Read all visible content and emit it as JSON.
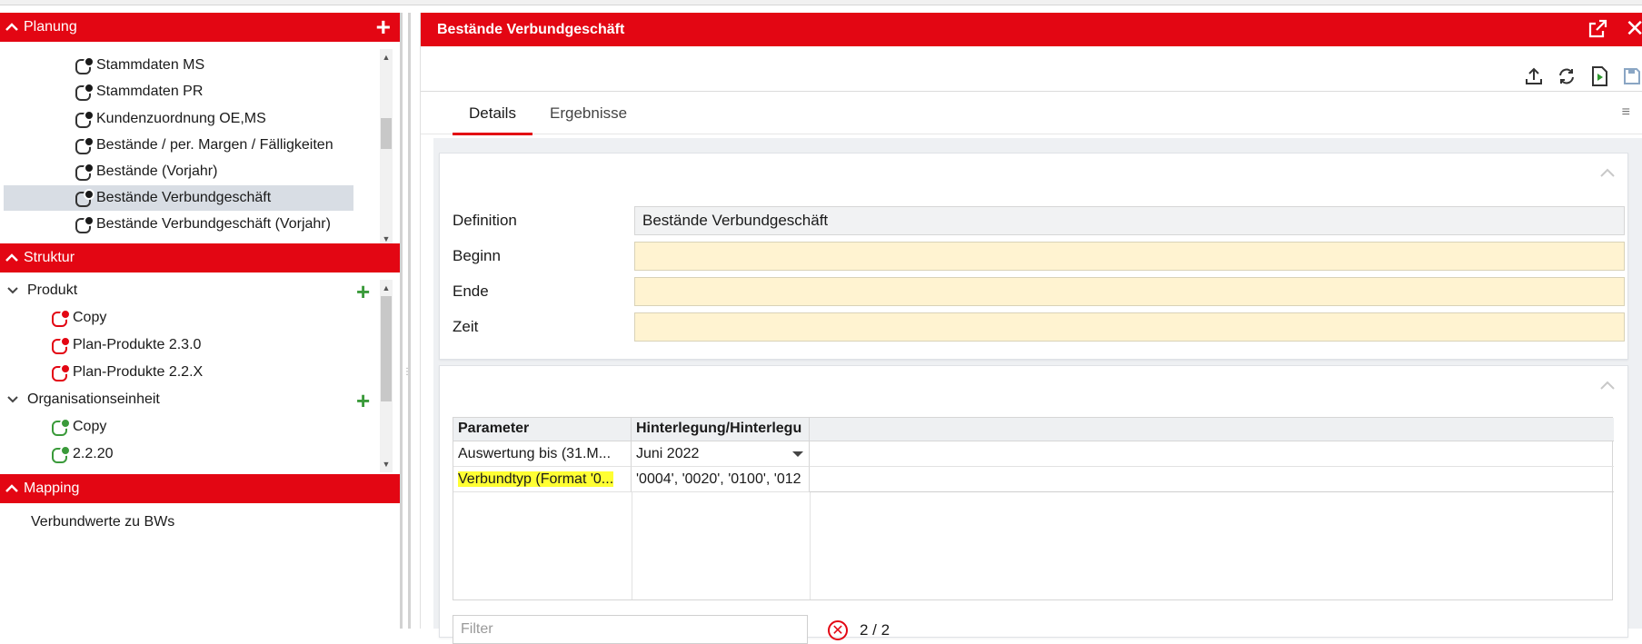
{
  "colors": {
    "accent": "#e30613",
    "selected_row": "#d8dde4",
    "input_required": "#fff3d1",
    "highlight": "#ffff33",
    "green": "#3a9a3a"
  },
  "left": {
    "planung": {
      "title": "Planung",
      "items": [
        {
          "label": "Stammdaten MS"
        },
        {
          "label": "Stammdaten PR"
        },
        {
          "label": "Kundenzuordnung OE,MS"
        },
        {
          "label": "Bestände / per. Margen / Fälligkeiten"
        },
        {
          "label": "Bestände (Vorjahr)"
        },
        {
          "label": "Bestände Verbundgeschäft"
        },
        {
          "label": "Bestände Verbundgeschäft (Vorjahr)"
        }
      ]
    },
    "struktur": {
      "title": "Struktur",
      "groups": [
        {
          "label": "Produkt",
          "children": [
            {
              "label": "Copy"
            },
            {
              "label": "Plan-Produkte 2.3.0"
            },
            {
              "label": "Plan-Produkte 2.2.X"
            }
          ]
        },
        {
          "label": "Organisationseinheit",
          "children": [
            {
              "label": "Copy"
            },
            {
              "label": "2.2.20"
            }
          ]
        }
      ]
    },
    "mapping": {
      "title": "Mapping",
      "items": [
        {
          "label": "Verbundwerte zu BWs"
        }
      ]
    }
  },
  "right": {
    "title": "Bestände Verbundgeschäft",
    "tabs": [
      {
        "label": "Details"
      },
      {
        "label": "Ergebnisse"
      }
    ],
    "form": {
      "definition_label": "Definition",
      "definition_value": "Bestände Verbundgeschäft",
      "beginn_label": "Beginn",
      "ende_label": "Ende",
      "zeit_label": "Zeit"
    },
    "grid": {
      "headers": [
        "Parameter",
        "Hinterlegung/Hinterlegu"
      ],
      "rows": [
        {
          "param": "Auswertung bis (31.M...",
          "value": "Juni 2022"
        },
        {
          "param": "Verbundtyp (Format '0...",
          "value": "'0004', '0020', '0100', '012"
        }
      ]
    },
    "filter_placeholder": "Filter",
    "count": "2 / 2"
  }
}
